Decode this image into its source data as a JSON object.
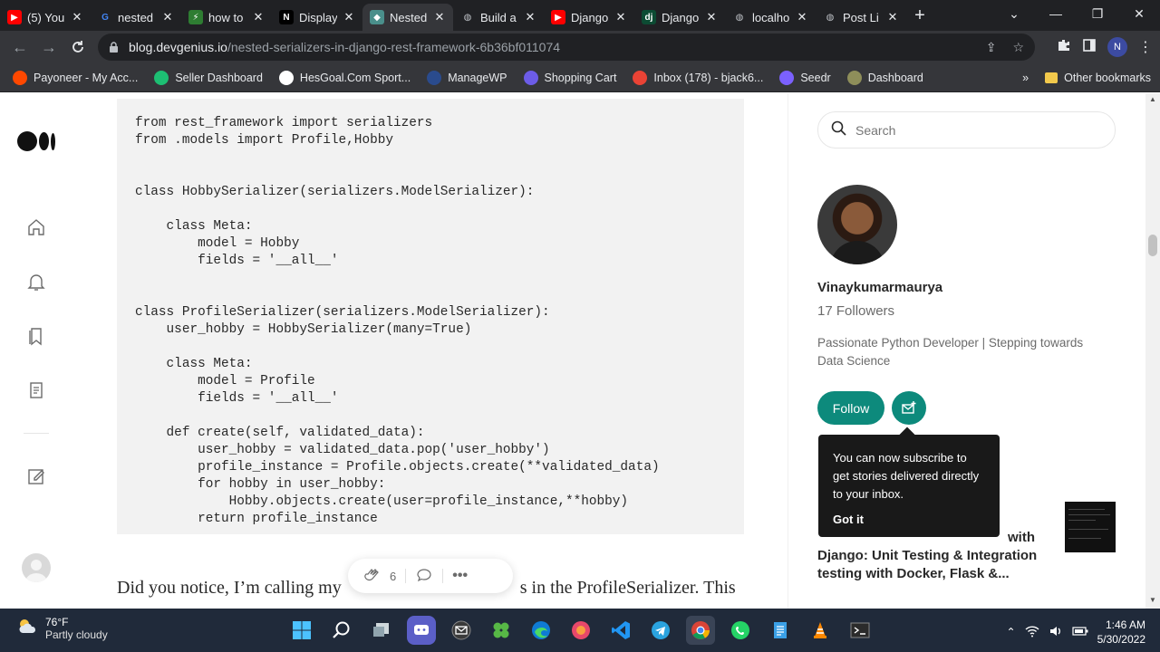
{
  "browser": {
    "tabs": [
      {
        "title": "(5) You",
        "fav": "youtube",
        "color": "#ff0000"
      },
      {
        "title": "nested",
        "fav": "google",
        "color": "#ffffff"
      },
      {
        "title": "how to",
        "fav": "wave",
        "color": "#2e7d32"
      },
      {
        "title": "Display",
        "fav": "notion",
        "color": "#000000"
      },
      {
        "title": "Nested",
        "fav": "devgenius",
        "color": "#4a8f8b"
      },
      {
        "title": "Build a",
        "fav": "globe",
        "color": "#5f6368"
      },
      {
        "title": "Django",
        "fav": "youtube",
        "color": "#ff0000"
      },
      {
        "title": "Django",
        "fav": "django",
        "color": "#0c4b33"
      },
      {
        "title": "localho",
        "fav": "globe",
        "color": "#5f6368"
      },
      {
        "title": "Post Li",
        "fav": "globe",
        "color": "#5f6368"
      }
    ],
    "url_host": "blog.devgenius.io",
    "url_path": "/nested-serializers-in-django-rest-framework-6b36bf011074",
    "profile_initial": "N",
    "bookmarks": [
      {
        "label": "Payoneer - My Acc...",
        "color": "#ff4800"
      },
      {
        "label": "Seller Dashboard",
        "color": "#1dbf73"
      },
      {
        "label": "HesGoal.Com Sport...",
        "color": "#ffffff"
      },
      {
        "label": "ManageWP",
        "color": "#2a4b8d"
      },
      {
        "label": "Shopping Cart",
        "color": "#6c5ce7"
      },
      {
        "label": "Inbox (178) - bjack6...",
        "color": "#ea4335"
      },
      {
        "label": "Seedr",
        "color": "#7b61ff"
      },
      {
        "label": "Dashboard",
        "color": "#8e8e5a"
      }
    ],
    "bookmarks_more": "»",
    "other_bookmarks": "Other bookmarks"
  },
  "article": {
    "code": "from rest_framework import serializers\nfrom .models import Profile,Hobby\n\n\nclass HobbySerializer(serializers.ModelSerializer):\n\n    class Meta:\n        model = Hobby\n        fields = '__all__'\n\n\nclass ProfileSerializer(serializers.ModelSerializer):\n    user_hobby = HobbySerializer(many=True)\n\n    class Meta:\n        model = Profile\n        fields = '__all__'\n\n    def create(self, validated_data):\n        user_hobby = validated_data.pop('user_hobby')\n        profile_instance = Profile.objects.create(**validated_data)\n        for hobby in user_hobby:\n            Hobby.objects.create(user=profile_instance,**hobby)\n        return profile_instance",
    "paragraph_start": "Did you notice, I’m calling my ",
    "paragraph_mid": "s in the ProfileSerializer. This",
    "clap_count": "6"
  },
  "sidebar": {
    "search_placeholder": "Search",
    "author_name": "Vinaykumarmaurya",
    "followers": "17 Followers",
    "bio": "Passionate Python Developer | Stepping towards Data Science",
    "follow_label": "Follow",
    "tooltip_text": "You can now subscribe to get stories delivered directly to your inbox.",
    "tooltip_action": "Got it",
    "related_title_line1": "with",
    "related_title_line2": "Django: Unit Testing & Integration",
    "related_title_line3": "testing with Docker, Flask &..."
  },
  "taskbar": {
    "temperature": "76°F",
    "condition": "Partly cloudy",
    "time": "1:46 AM",
    "date": "5/30/2022"
  }
}
